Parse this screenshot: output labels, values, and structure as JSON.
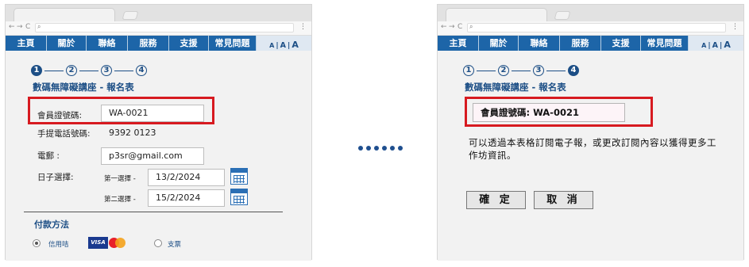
{
  "nav": {
    "items": [
      "主頁",
      "關於",
      "聯絡",
      "服務",
      "支援",
      "常見問題"
    ],
    "font_size": {
      "small": "A",
      "medium": "A",
      "large": "A",
      "separator": "|"
    }
  },
  "browser": {
    "back": "←",
    "forward": "→",
    "reload": "C",
    "search_icon": "search-icon",
    "menu": "⋮"
  },
  "form_page": {
    "steps": [
      "1",
      "2",
      "3",
      "4"
    ],
    "active_step": 1,
    "title": "數碼無障礙講座 - 報名表",
    "member_label": "會員證號碼:",
    "member_value": "WA-0021",
    "phone_label": "手提電話號碼:",
    "phone_value": "9392 0123",
    "email_label": "電郵 :",
    "email_value": "p3sr@gmail.com",
    "date_label": "日子選擇:",
    "first_choice_label": "第一選擇 -",
    "first_choice_value": "13/2/2024",
    "second_choice_label": "第二選擇 -",
    "second_choice_value": "15/2/2024",
    "payment_title": "付款方法",
    "credit_card_label": "信用咭",
    "visa_text": "VISA",
    "cheque_label": "支票"
  },
  "confirm_page": {
    "steps": [
      "1",
      "2",
      "3",
      "4"
    ],
    "active_step": 4,
    "title": "數碼無障礙講座 - 報名表",
    "member_text": "會員證號碼: WA-0021",
    "message": "可以透過本表格訂閱電子報，或更改訂閱內容以獲得更多工作坊資訊。",
    "confirm_button": "確 定",
    "cancel_button": "取 消"
  },
  "colors": {
    "nav_blue": "#1d65a8",
    "title_blue": "#1d4f86",
    "highlight_red": "#d71a20"
  },
  "icons": [
    "calendar-icon",
    "visa-logo",
    "mastercard-logo",
    "search-icon"
  ]
}
